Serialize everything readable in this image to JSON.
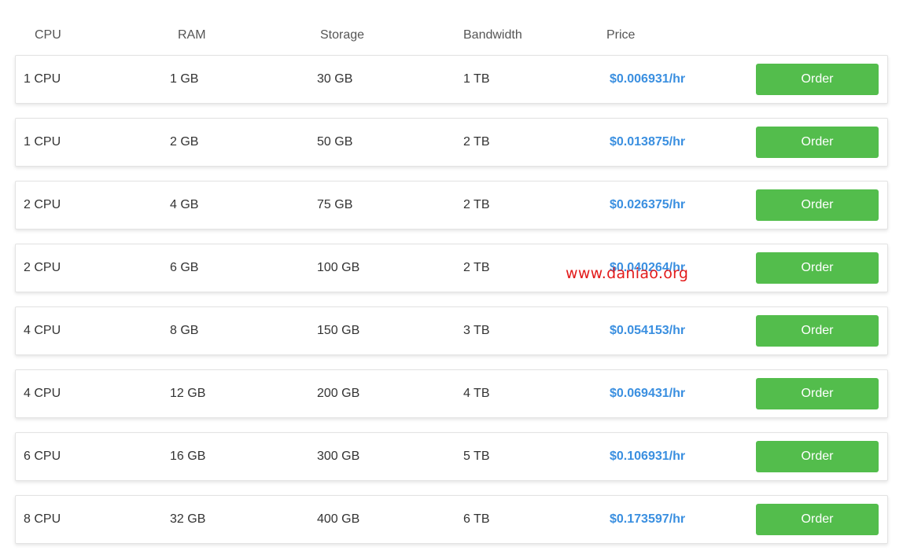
{
  "header": {
    "cpu": "CPU",
    "ram": "RAM",
    "storage": "Storage",
    "bandwidth": "Bandwidth",
    "price": "Price"
  },
  "plans": [
    {
      "cpu": "1 CPU",
      "ram": "1 GB",
      "storage": "30 GB",
      "bandwidth": "1 TB",
      "price": "$0.006931/hr",
      "order_label": "Order"
    },
    {
      "cpu": "1 CPU",
      "ram": "2 GB",
      "storage": "50 GB",
      "bandwidth": "2 TB",
      "price": "$0.013875/hr",
      "order_label": "Order"
    },
    {
      "cpu": "2 CPU",
      "ram": "4 GB",
      "storage": "75 GB",
      "bandwidth": "2 TB",
      "price": "$0.026375/hr",
      "order_label": "Order"
    },
    {
      "cpu": "2 CPU",
      "ram": "6 GB",
      "storage": "100 GB",
      "bandwidth": "2 TB",
      "price": "$0.040264/hr",
      "order_label": "Order"
    },
    {
      "cpu": "4 CPU",
      "ram": "8 GB",
      "storage": "150 GB",
      "bandwidth": "3 TB",
      "price": "$0.054153/hr",
      "order_label": "Order"
    },
    {
      "cpu": "4 CPU",
      "ram": "12 GB",
      "storage": "200 GB",
      "bandwidth": "4 TB",
      "price": "$0.069431/hr",
      "order_label": "Order"
    },
    {
      "cpu": "6 CPU",
      "ram": "16 GB",
      "storage": "300 GB",
      "bandwidth": "5 TB",
      "price": "$0.106931/hr",
      "order_label": "Order"
    },
    {
      "cpu": "8 CPU",
      "ram": "32 GB",
      "storage": "400 GB",
      "bandwidth": "6 TB",
      "price": "$0.173597/hr",
      "order_label": "Order"
    }
  ],
  "watermark": "www.daniao.org",
  "colors": {
    "price": "#3a8fe0",
    "order_button": "#53bd4c",
    "watermark": "#e31b1b"
  }
}
